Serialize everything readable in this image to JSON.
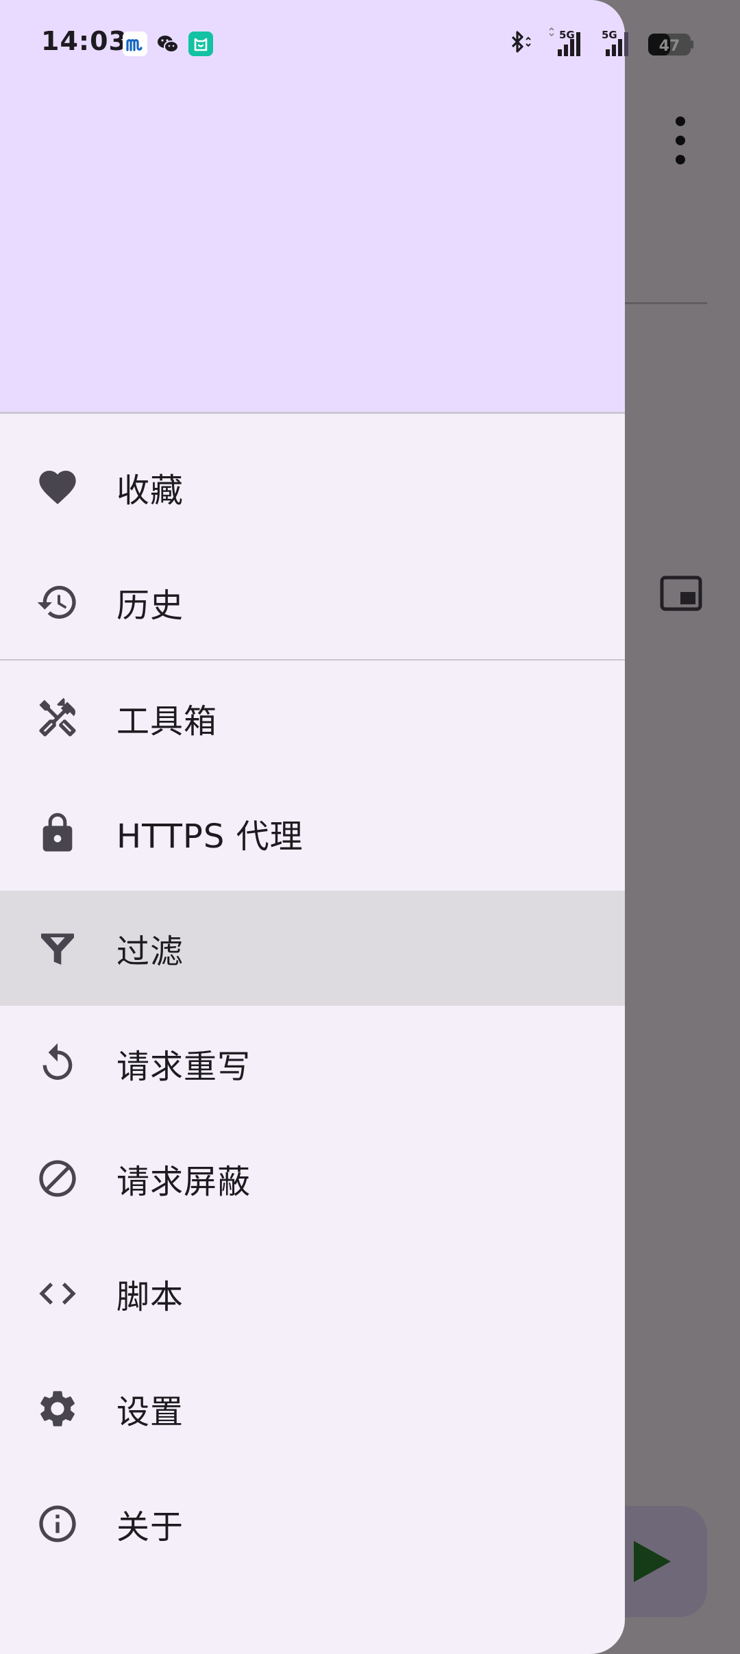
{
  "status_bar": {
    "time": "14:03",
    "network_1": "5G",
    "network_2": "5G",
    "battery": "47"
  },
  "menu": {
    "items": [
      {
        "label": "收藏",
        "icon": "heart-icon"
      },
      {
        "label": "历史",
        "icon": "history-icon"
      },
      {
        "label": "工具箱",
        "icon": "tools-icon"
      },
      {
        "label": "HTTPS 代理",
        "icon": "lock-icon"
      },
      {
        "label": "过滤",
        "icon": "filter-icon",
        "selected": true
      },
      {
        "label": "请求重写",
        "icon": "refresh-icon"
      },
      {
        "label": "请求屏蔽",
        "icon": "block-icon"
      },
      {
        "label": "脚本",
        "icon": "code-icon"
      },
      {
        "label": "设置",
        "icon": "gear-icon"
      },
      {
        "label": "关于",
        "icon": "info-icon"
      }
    ]
  },
  "colors": {
    "header_bg": "#e9dbff",
    "drawer_bg": "#f4eff8",
    "selected_bg": "#dedbe0",
    "icon": "#49454f",
    "text": "#1d1b20",
    "fab_play": "#2e7d32"
  }
}
